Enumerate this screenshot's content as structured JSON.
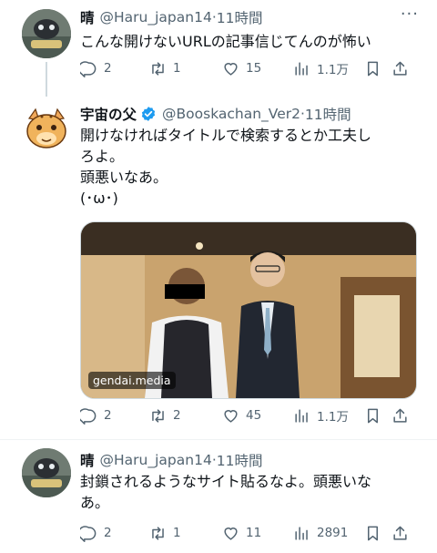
{
  "tweets": [
    {
      "name": "晴",
      "handle": "@Haru_japan14",
      "time": "11時間",
      "text_lines": [
        "こんな開けないURLの記事信じてんのが怖い"
      ],
      "replies": "2",
      "retweets": "1",
      "likes": "15",
      "views": "1.1万"
    },
    {
      "name": "宇宙の父",
      "handle": "@Booskachan_Ver2",
      "time": "11時間",
      "verified": true,
      "text_lines": [
        "開けなければタイトルで検索するとか工夫し",
        "ろよ。",
        "頭悪いなあ。",
        "(･ω･)"
      ],
      "media_caption": "gendai.media",
      "replies": "2",
      "retweets": "2",
      "likes": "45",
      "views": "1.1万"
    },
    {
      "name": "晴",
      "handle": "@Haru_japan14",
      "time": "11時間",
      "text_lines": [
        "封鎖されるようなサイト貼るなよ。頭悪いな",
        "あ。"
      ],
      "replies": "2",
      "retweets": "1",
      "likes": "11",
      "views": "2891"
    }
  ],
  "dot": "·",
  "more": "···",
  "colors": {
    "text": "#0f1419",
    "secondary": "#536471",
    "verified": "#1d9bf0",
    "thread_line": "#cfd9de"
  }
}
